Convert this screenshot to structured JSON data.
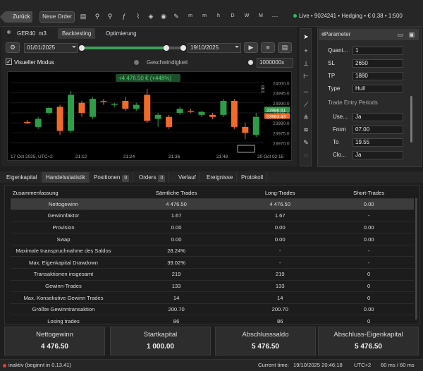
{
  "topbar": {
    "back_label": "Zurück",
    "new_order_label": "Neue Order",
    "live_status": "Live • 9024241 • Hedging • € 0.38 • 1:500",
    "accent_green": "#27c35d"
  },
  "tabs": {
    "symbol": "GER40",
    "timeframe": "m3",
    "backtesting": "Backtesting",
    "optimization": "Optimierung"
  },
  "backtest": {
    "start_date": "01/01/2025",
    "end_date": "19/10/2025",
    "visual_mode_label": "Visueller Modus",
    "speed_label": "Geschwindigkeit",
    "speed_value": "1000000x"
  },
  "chart": {
    "pl_badge": "+4 476.50 € (+448%)",
    "price_labels": [
      "24000.0",
      "23995.0",
      "23990.0",
      "23985.0",
      "23980.0",
      "23975.0",
      "23970.0"
    ],
    "bid_tag": "23986.61",
    "ask_tag": "23983.43",
    "time_labels": [
      "17 Oct 2025, UTC+2",
      "21:12",
      "21:24",
      "21:36",
      "21:48",
      "20 Oct 02:15"
    ],
    "scale_label": "100",
    "bull_color": "#2e9d4a",
    "bear_color": "#f06a2a"
  },
  "parameters": {
    "title": "Parameter",
    "quantity_label": "Quant...",
    "quantity_value": "1",
    "sl_label": "SL",
    "sl_value": "2650",
    "tp_label": "TP",
    "tp_value": "1880",
    "type_label": "Type",
    "type_value": "Hull",
    "section_label": "Trade Entry Periods",
    "use_label": "Use...",
    "use_value": "Ja",
    "from_label": "From",
    "from_value": "07.00",
    "to_label": "To",
    "to_value": "19.55",
    "close_label": "Clo...",
    "close_value": "Ja"
  },
  "bottom_tabs": {
    "equity": "Eigenkapital",
    "stats": "Handelsstatistik",
    "positions": "Positionen",
    "positions_count": "0",
    "orders": "Orders",
    "orders_count": "0",
    "history": "Verlauf",
    "events": "Ereignisse",
    "log": "Protokoll"
  },
  "stats": {
    "headers": [
      "Zusammenfassung",
      "Sämtliche Trades",
      "Long-Trades",
      "Short-Trades"
    ],
    "rows": [
      [
        "Nettogewinn",
        "4 476.50",
        "4 476.50",
        "0.00"
      ],
      [
        "Gewinnfaktor",
        "1.67",
        "1.67",
        "-"
      ],
      [
        "Provision",
        "0.00",
        "0.00",
        "0.00"
      ],
      [
        "Swap",
        "0.00",
        "0.00",
        "0.00"
      ],
      [
        "Maximale Inanspruchnahme des Saldos",
        "28.24%",
        "-",
        "-"
      ],
      [
        "Max. Eigenkapital Drawdown",
        "39.02%",
        "-",
        "-"
      ],
      [
        "Transaktionen insgesamt",
        "219",
        "219",
        "0"
      ],
      [
        "Gewinn-Trades",
        "133",
        "133",
        "0"
      ],
      [
        "Max. Konsekutive Gewinn Trades",
        "14",
        "14",
        "0"
      ],
      [
        "Größte Gewinntransaktion",
        "200.70",
        "200.70",
        "0.00"
      ],
      [
        "Losing trades",
        "86",
        "86",
        "0"
      ]
    ]
  },
  "summary": [
    {
      "title": "Nettogewinn",
      "value": "4 476.50"
    },
    {
      "title": "Startkapital",
      "value": "1 000.00"
    },
    {
      "title": "Abschlusssaldo",
      "value": "5 476.50"
    },
    {
      "title": "Abschluss-Eigenkapital",
      "value": "5 476.50"
    }
  ],
  "statusbar": {
    "status": "inaktiv (beginnt in 0.13.41)",
    "current_time_label": "Current time:",
    "current_time": "19/10/2025 20:46:18",
    "timezone": "UTC+2",
    "latency": "60 ms / 60 ms",
    "status_color": "#e04040"
  },
  "chart_data": {
    "type": "candlestick",
    "ylim": [
      23966,
      24004
    ],
    "candles": [
      {
        "o": 23980.5,
        "h": 23981.5,
        "l": 23979.5,
        "c": 23979.8
      },
      {
        "o": 23978,
        "h": 23983,
        "l": 23977,
        "c": 23982
      },
      {
        "o": 23985,
        "h": 23988,
        "l": 23984,
        "c": 23987.5
      },
      {
        "o": 23988,
        "h": 23989,
        "l": 23974,
        "c": 23976
      },
      {
        "o": 23976,
        "h": 23996,
        "l": 23975,
        "c": 23994
      },
      {
        "o": 23990,
        "h": 23991,
        "l": 23983,
        "c": 23985
      },
      {
        "o": 23983,
        "h": 23993,
        "l": 23982,
        "c": 23992
      },
      {
        "o": 23991,
        "h": 23992,
        "l": 23989,
        "c": 23990.5
      },
      {
        "o": 23989,
        "h": 23990,
        "l": 23988,
        "c": 23989.5
      },
      {
        "o": 23991,
        "h": 23993,
        "l": 23986,
        "c": 23987
      },
      {
        "o": 23987,
        "h": 23990,
        "l": 23986,
        "c": 23989
      },
      {
        "o": 23994,
        "h": 23997,
        "l": 23980,
        "c": 23981
      },
      {
        "o": 23982,
        "h": 23985,
        "l": 23978,
        "c": 23984
      },
      {
        "o": 23983,
        "h": 23984,
        "l": 23977,
        "c": 23978
      },
      {
        "o": 23985,
        "h": 23988,
        "l": 23984,
        "c": 23987
      },
      {
        "o": 23986,
        "h": 23987,
        "l": 23985,
        "c": 23985.5
      },
      {
        "o": 23984,
        "h": 23986,
        "l": 23983,
        "c": 23985.5
      },
      {
        "o": 23984,
        "h": 23985,
        "l": 23982,
        "c": 23983
      },
      {
        "o": 23984,
        "h": 23992,
        "l": 23983,
        "c": 23991
      },
      {
        "o": 23991,
        "h": 23992,
        "l": 23977,
        "c": 23978
      },
      {
        "o": 23978,
        "h": 23980,
        "l": 23972,
        "c": 23975
      },
      {
        "o": 23974,
        "h": 23985,
        "l": 23973,
        "c": 23983
      }
    ]
  }
}
